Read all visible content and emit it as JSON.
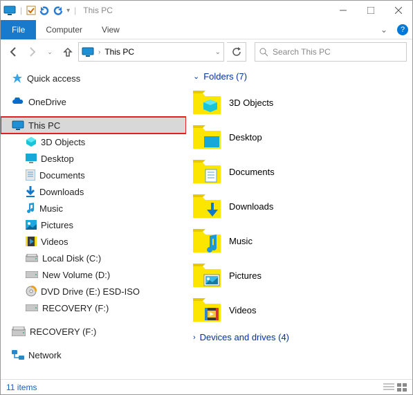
{
  "window": {
    "title": "This PC"
  },
  "ribbon": {
    "file": "File",
    "tabs": [
      "Computer",
      "View"
    ]
  },
  "address": {
    "location": "This PC"
  },
  "search": {
    "placeholder": "Search This PC"
  },
  "sidebar": {
    "quick_access": "Quick access",
    "onedrive": "OneDrive",
    "this_pc": "This PC",
    "children": [
      "3D Objects",
      "Desktop",
      "Documents",
      "Downloads",
      "Music",
      "Pictures",
      "Videos",
      "Local Disk (C:)",
      "New Volume (D:)",
      "DVD Drive (E:) ESD-ISO",
      "RECOVERY (F:)"
    ],
    "recovery_dup": "RECOVERY (F:)",
    "network": "Network"
  },
  "content": {
    "folders_header": "Folders (7)",
    "folders": [
      "3D Objects",
      "Desktop",
      "Documents",
      "Downloads",
      "Music",
      "Pictures",
      "Videos"
    ],
    "devices_header": "Devices and drives (4)"
  },
  "status": {
    "items": "11 items"
  }
}
